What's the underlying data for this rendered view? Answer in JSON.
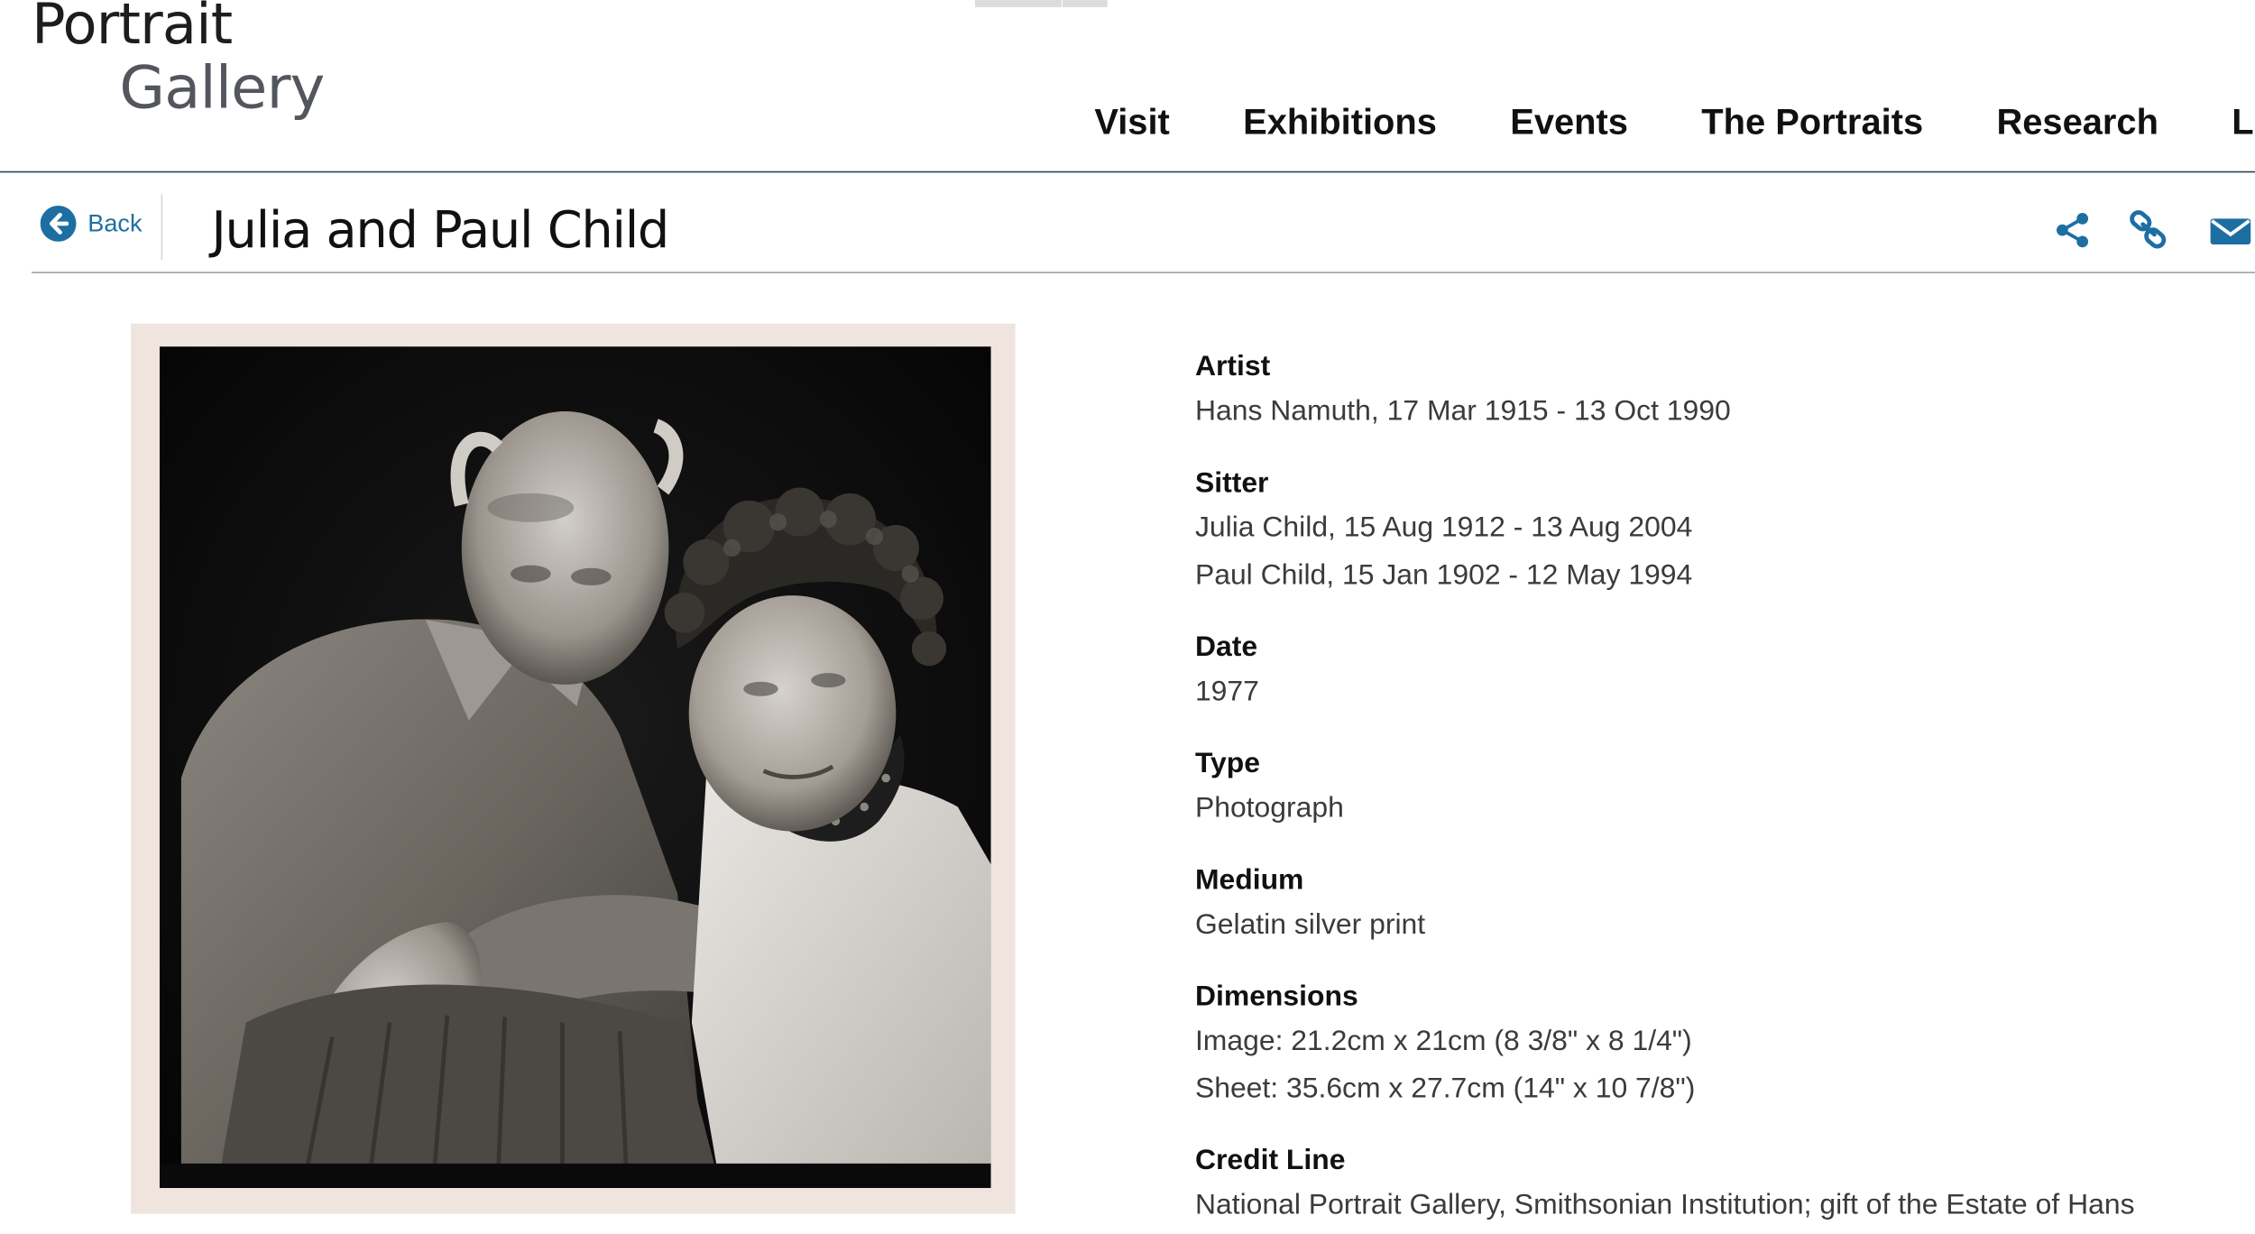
{
  "logo": {
    "line1": "Portrait",
    "line2": "Gallery"
  },
  "nav": {
    "items": [
      "Visit",
      "Exhibitions",
      "Events",
      "The Portraits",
      "Research",
      "L"
    ]
  },
  "subbar": {
    "back_label": "Back",
    "title": "Julia and Paul Child",
    "actions": [
      "share-icon",
      "link-icon",
      "email-icon"
    ]
  },
  "colors": {
    "link_blue": "#1d6fa3",
    "header_rule": "#2e4350",
    "photo_mat": "#efe5de"
  },
  "metadata": {
    "artist": {
      "label": "Artist",
      "values": [
        "Hans Namuth, 17 Mar 1915 - 13 Oct 1990"
      ]
    },
    "sitter": {
      "label": "Sitter",
      "values": [
        "Julia Child, 15 Aug 1912 - 13 Aug 2004",
        "Paul Child, 15 Jan 1902 - 12 May 1994"
      ]
    },
    "date": {
      "label": "Date",
      "values": [
        "1977"
      ]
    },
    "type": {
      "label": "Type",
      "values": [
        "Photograph"
      ]
    },
    "medium": {
      "label": "Medium",
      "values": [
        "Gelatin silver print"
      ]
    },
    "dimensions": {
      "label": "Dimensions",
      "values": [
        "Image: 21.2cm x 21cm (8 3/8\" x 8 1/4\")",
        "Sheet: 35.6cm x 27.7cm (14\" x 10 7/8\")"
      ]
    },
    "credit_line": {
      "label": "Credit Line",
      "values": [
        "National Portrait Gallery, Smithsonian Institution; gift of the Estate of Hans"
      ]
    }
  }
}
